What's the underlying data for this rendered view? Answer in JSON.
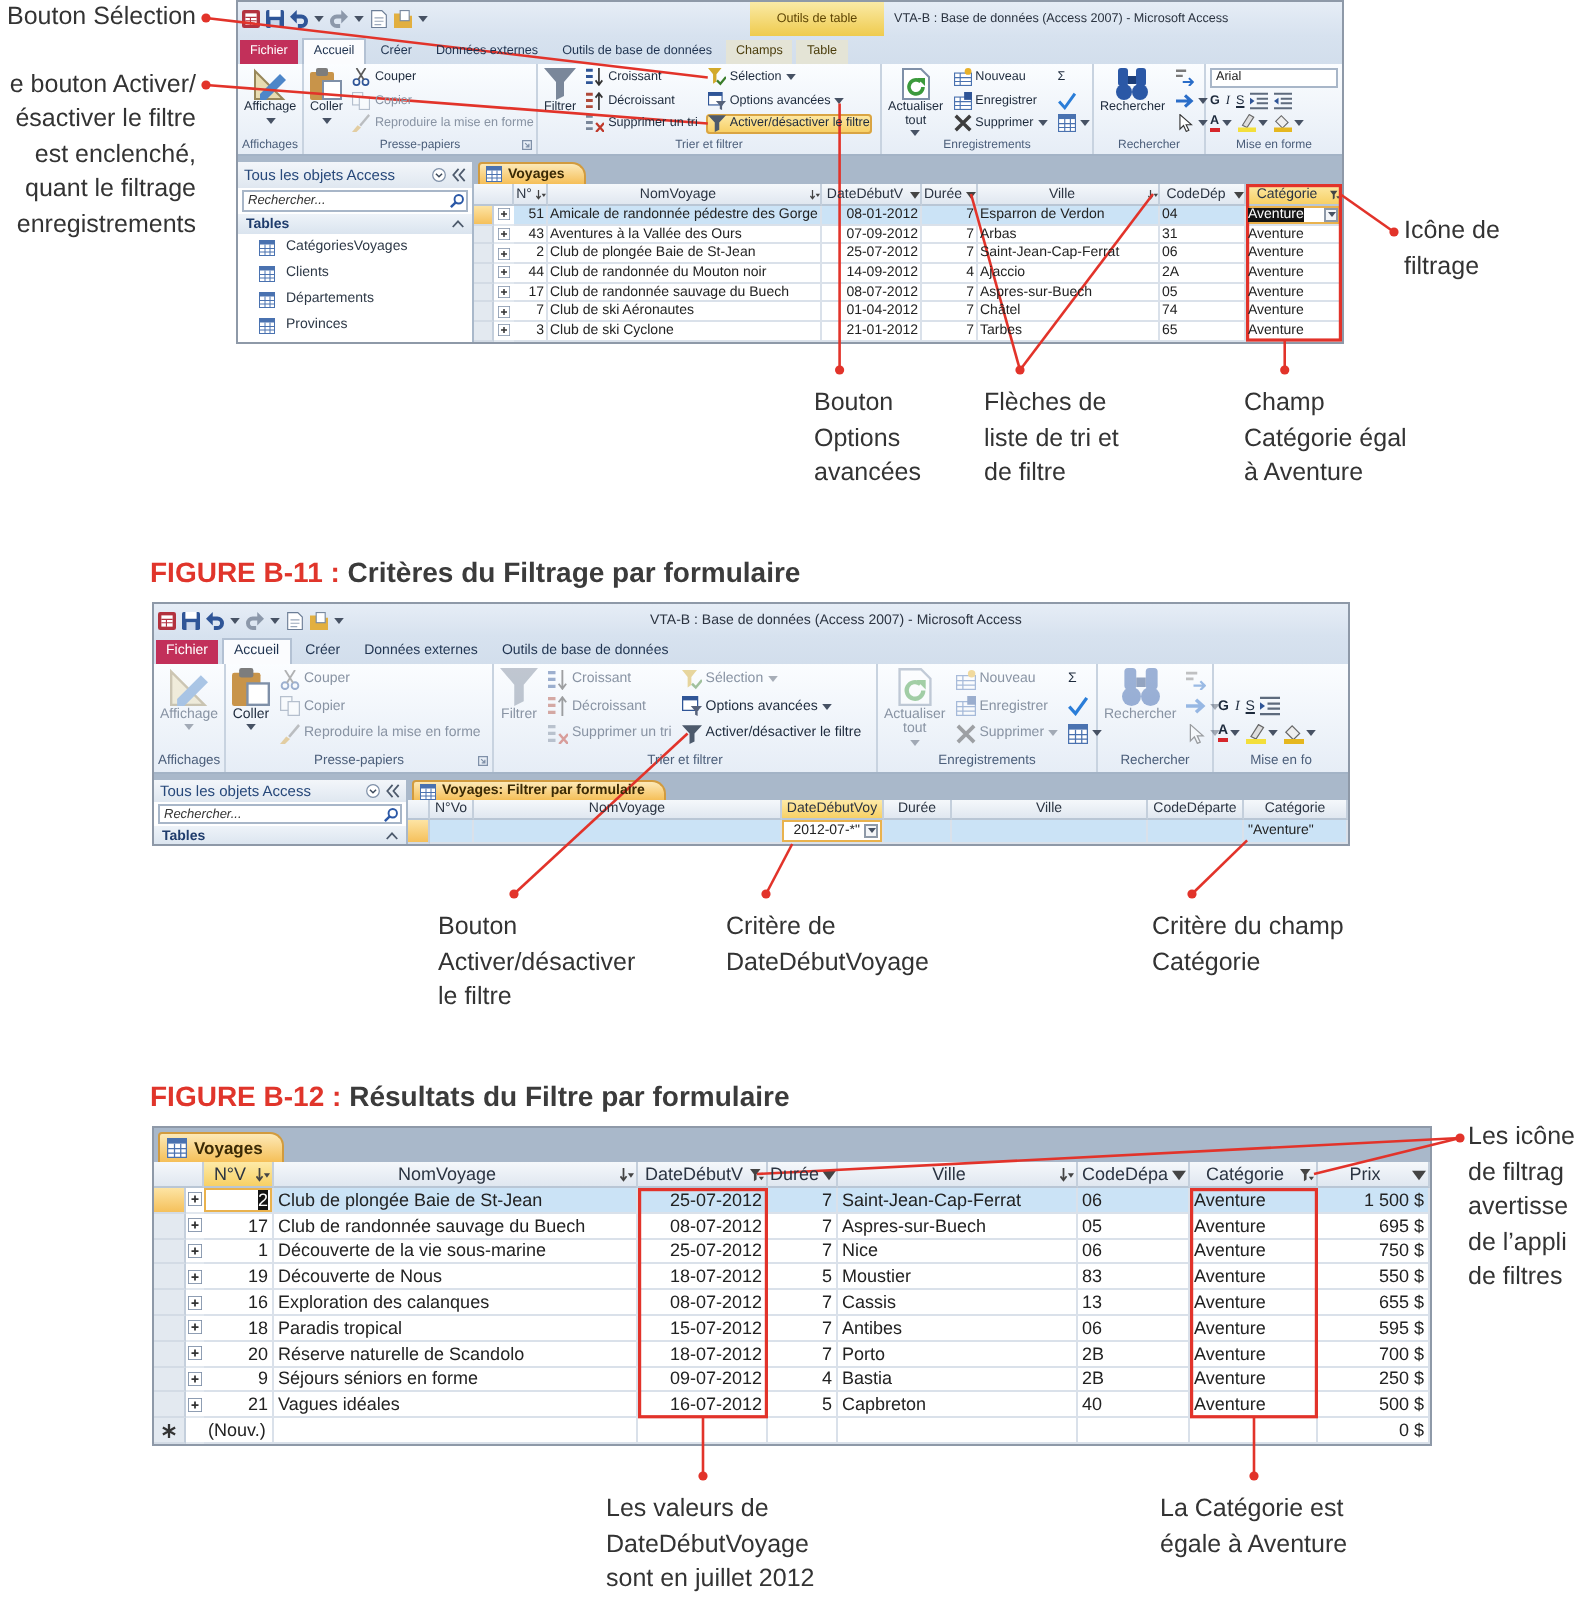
{
  "figure_1": {
    "callouts_left": [
      {
        "lines": [
          "Bouton Sélection"
        ]
      },
      {
        "lines": [
          "e bouton Activer/",
          "ésactiver le filtre",
          "est enclenché,",
          "quant le filtrage",
          "enregistrements"
        ]
      }
    ],
    "window": {
      "title": "VTA-B : Base de données (Access 2007) - Microsoft Access",
      "context_group": "Outils de table",
      "tabs": [
        {
          "label": "Fichier",
          "kind": "file",
          "selected": false
        },
        {
          "label": "Accueil",
          "kind": "tab",
          "selected": true
        },
        {
          "label": "Créer",
          "kind": "tab",
          "selected": false
        },
        {
          "label": "Données externes",
          "kind": "tab",
          "selected": false
        },
        {
          "label": "Outils de base de données",
          "kind": "tab",
          "selected": false
        },
        {
          "label": "Champs",
          "kind": "context",
          "selected": false
        },
        {
          "label": "Table",
          "kind": "context",
          "selected": false
        }
      ],
      "ribbon": [
        {
          "label": "Affichages",
          "kind": "buttons",
          "controls": [
            {
              "kind": "large",
              "label": "Affichage",
              "menu": true,
              "disabled": false
            }
          ]
        },
        {
          "label": "Presse-papiers",
          "kind": "buttons",
          "launcher": true,
          "controls": [
            {
              "kind": "large",
              "label": "Coller",
              "menu": true,
              "disabled": false
            },
            {
              "kind": "small",
              "label": "Couper",
              "disabled": false
            },
            {
              "kind": "small",
              "label": "Copier",
              "disabled": true
            },
            {
              "kind": "small",
              "label": "Reproduire la mise en forme",
              "disabled": true
            }
          ]
        },
        {
          "label": "Trier et filtrer",
          "kind": "buttons",
          "controls": [
            {
              "kind": "large",
              "label": "Filtrer",
              "disabled": false
            },
            {
              "kind": "small",
              "label": "Croissant",
              "disabled": false
            },
            {
              "kind": "small",
              "label": "Décroissant",
              "disabled": false
            },
            {
              "kind": "small",
              "label": "Supprimer un tri",
              "disabled": false
            },
            {
              "kind": "small",
              "label": "Sélection",
              "menu": true,
              "disabled": false
            },
            {
              "kind": "small",
              "label": "Options avancées",
              "menu": true,
              "disabled": false
            },
            {
              "kind": "small",
              "label": "Activer/désactiver le filtre",
              "disabled": false,
              "pressed": true
            }
          ]
        },
        {
          "label": "Enregistrements",
          "kind": "buttons",
          "controls": [
            {
              "kind": "large",
              "label": "Actualiser tout",
              "menu": true,
              "disabled": false
            },
            {
              "kind": "small",
              "label": "Nouveau",
              "disabled": false
            },
            {
              "kind": "small",
              "label": "Enregistrer",
              "disabled": false
            },
            {
              "kind": "small",
              "label": "Supprimer",
              "menu": true,
              "disabled": false
            },
            {
              "kind": "icon",
              "label": "Σ",
              "disabled": false
            },
            {
              "kind": "icon",
              "disabled": false
            },
            {
              "kind": "icon",
              "menu": true,
              "disabled": false
            }
          ]
        },
        {
          "label": "Rechercher",
          "kind": "buttons",
          "controls": [
            {
              "kind": "large",
              "label": "Rechercher",
              "disabled": false
            },
            {
              "kind": "icon",
              "disabled": false
            },
            {
              "kind": "icon",
              "menu": true,
              "disabled": false
            },
            {
              "kind": "icon",
              "menu": true,
              "disabled": false
            }
          ]
        },
        {
          "label": "Mise en forme",
          "kind": "format",
          "font": "Arial",
          "rows": [
            [
              {
                "kind": "bold",
                "label": "G"
              },
              {
                "kind": "italic",
                "label": "I"
              },
              {
                "kind": "underline",
                "label": "S"
              },
              {
                "kind": "icon"
              },
              {
                "kind": "icon"
              }
            ],
            [
              {
                "kind": "color",
                "label": "A",
                "menu": true
              },
              {
                "kind": "icon",
                "menu": true
              },
              {
                "kind": "icon",
                "menu": true
              }
            ]
          ]
        }
      ],
      "navigation_pane": {
        "title": "Tous les objets Access",
        "search": {
          "placeholder": "Rechercher..."
        },
        "section": "Tables",
        "items": [
          "CatégoriesVoyages",
          "Clients",
          "Départements",
          "Provinces"
        ]
      },
      "datasheet": {
        "tab": "Voyages",
        "expandable": true,
        "column_menus": true,
        "focus_dropdown": true,
        "columns": [
          {
            "label": "N°",
            "kind": "number",
            "sorted": true,
            "filtered": false,
            "selected": false
          },
          {
            "label": "NomVoyage",
            "kind": "text",
            "sorted": true,
            "filtered": false,
            "selected": false
          },
          {
            "label": "DateDébutV",
            "kind": "date",
            "sorted": false,
            "filtered": false,
            "selected": false
          },
          {
            "label": "Durée",
            "kind": "number",
            "sorted": false,
            "filtered": false,
            "selected": false
          },
          {
            "label": "Ville",
            "kind": "text",
            "sorted": true,
            "filtered": false,
            "selected": false
          },
          {
            "label": "CodeDép",
            "kind": "text",
            "sorted": false,
            "filtered": false,
            "selected": false
          },
          {
            "label": "Catégorie",
            "kind": "text",
            "sorted": false,
            "filtered": true,
            "selected": true,
            "framed": true
          }
        ],
        "rows": [
          {
            "kind": "record",
            "selected": true,
            "cells": [
              "51",
              "Amicale de randonnée pédestre des Gorge",
              "08-01-2012",
              "7",
              "Esparron de Verdon",
              "04",
              "Aventure"
            ]
          },
          {
            "kind": "record",
            "selected": false,
            "cells": [
              "43",
              "Aventures à la Vallée des Ours",
              "07-09-2012",
              "7",
              "Arbas",
              "31",
              "Aventure"
            ]
          },
          {
            "kind": "record",
            "selected": false,
            "cells": [
              "2",
              "Club de plongée Baie de St-Jean",
              "25-07-2012",
              "7",
              "Saint-Jean-Cap-Ferrat",
              "06",
              "Aventure"
            ]
          },
          {
            "kind": "record",
            "selected": false,
            "cells": [
              "44",
              "Club de randonnée du Mouton noir",
              "14-09-2012",
              "4",
              "Ajaccio",
              "2A",
              "Aventure"
            ]
          },
          {
            "kind": "record",
            "selected": false,
            "cells": [
              "17",
              "Club de randonnée sauvage du Buech",
              "08-07-2012",
              "7",
              "Aspres-sur-Buech",
              "05",
              "Aventure"
            ]
          },
          {
            "kind": "record",
            "selected": false,
            "cells": [
              "7",
              "Club de ski Aéronautes",
              "01-04-2012",
              "7",
              "Châtel",
              "74",
              "Aventure"
            ]
          },
          {
            "kind": "record",
            "selected": false,
            "cells": [
              "3",
              "Club de ski Cyclone",
              "21-01-2012",
              "7",
              "Tarbes",
              "65",
              "Aventure"
            ]
          }
        ]
      }
    },
    "callouts_right": [
      {
        "lines": [
          "Icône de",
          "filtrage"
        ]
      }
    ],
    "callouts_below": [
      {
        "lines": [
          "Bouton",
          "Options",
          "avancées"
        ]
      },
      {
        "lines": [
          "Flèches de",
          "liste de tri et",
          "de filtre"
        ]
      },
      {
        "lines": [
          "Champ",
          "Catégorie égal",
          "à Aventure"
        ]
      }
    ]
  },
  "figure_2": {
    "caption": {
      "number": "FIGURE B-11 :",
      "title": "Critères du Filtrage par formulaire"
    },
    "window": {
      "title": "VTA-B : Base de données (Access 2007) - Microsoft Access",
      "tabs": [
        {
          "label": "Fichier",
          "kind": "file",
          "selected": false
        },
        {
          "label": "Accueil",
          "kind": "tab",
          "selected": true
        },
        {
          "label": "Créer",
          "kind": "tab",
          "selected": false
        },
        {
          "label": "Données externes",
          "kind": "tab",
          "selected": false
        },
        {
          "label": "Outils de base de données",
          "kind": "tab",
          "selected": false
        }
      ],
      "ribbon": [
        {
          "label": "Affichages",
          "kind": "buttons",
          "controls": [
            {
              "kind": "large",
              "label": "Affichage",
              "menu": true,
              "disabled": true
            }
          ]
        },
        {
          "label": "Presse-papiers",
          "kind": "buttons",
          "launcher": true,
          "controls": [
            {
              "kind": "large",
              "label": "Coller",
              "menu": true,
              "disabled": false
            },
            {
              "kind": "small",
              "label": "Couper",
              "disabled": true
            },
            {
              "kind": "small",
              "label": "Copier",
              "disabled": true
            },
            {
              "kind": "small",
              "label": "Reproduire la mise en forme",
              "disabled": true
            }
          ]
        },
        {
          "label": "Trier et filtrer",
          "kind": "buttons",
          "controls": [
            {
              "kind": "large",
              "label": "Filtrer",
              "disabled": true
            },
            {
              "kind": "small",
              "label": "Croissant",
              "disabled": true
            },
            {
              "kind": "small",
              "label": "Décroissant",
              "disabled": true
            },
            {
              "kind": "small",
              "label": "Supprimer un tri",
              "disabled": true
            },
            {
              "kind": "small",
              "label": "Sélection",
              "menu": true,
              "disabled": true
            },
            {
              "kind": "small",
              "label": "Options avancées",
              "menu": true,
              "disabled": false
            },
            {
              "kind": "small",
              "label": "Activer/désactiver le filtre",
              "disabled": false,
              "pressed": false
            }
          ]
        },
        {
          "label": "Enregistrements",
          "kind": "buttons",
          "controls": [
            {
              "kind": "large",
              "label": "Actualiser tout",
              "menu": true,
              "disabled": true
            },
            {
              "kind": "small",
              "label": "Nouveau",
              "disabled": true
            },
            {
              "kind": "small",
              "label": "Enregistrer",
              "disabled": true
            },
            {
              "kind": "small",
              "label": "Supprimer",
              "menu": true,
              "disabled": true
            },
            {
              "kind": "icon",
              "label": "Σ",
              "disabled": false
            },
            {
              "kind": "icon",
              "disabled": false
            },
            {
              "kind": "icon",
              "menu": true,
              "disabled": false
            }
          ]
        },
        {
          "label": "Rechercher",
          "kind": "buttons",
          "controls": [
            {
              "kind": "large",
              "label": "Rechercher",
              "disabled": true
            },
            {
              "kind": "icon",
              "disabled": true
            },
            {
              "kind": "icon",
              "menu": true,
              "disabled": true
            },
            {
              "kind": "icon",
              "menu": true,
              "disabled": true
            }
          ]
        },
        {
          "label": "Mise en fo",
          "kind": "format",
          "rows": [
            [
              {
                "kind": "bold",
                "label": "G"
              },
              {
                "kind": "italic",
                "label": "I"
              },
              {
                "kind": "underline",
                "label": "S"
              },
              {
                "kind": "icon"
              }
            ],
            [
              {
                "kind": "color",
                "label": "A",
                "menu": true
              },
              {
                "kind": "icon",
                "menu": true
              },
              {
                "kind": "icon",
                "menu": true
              }
            ]
          ]
        }
      ],
      "navigation_pane": {
        "title": "Tous les objets Access",
        "search": {
          "placeholder": "Rechercher..."
        },
        "section": "Tables"
      },
      "datasheet": {
        "tab": "Voyages: Filtrer par formulaire",
        "focus_dropdown": true,
        "columns": [
          {
            "label": "N°Vo",
            "kind": "number",
            "selected": false
          },
          {
            "label": "NomVoyage",
            "kind": "text",
            "selected": false
          },
          {
            "label": "DateDébutVoy",
            "kind": "date",
            "selected": true
          },
          {
            "label": "Durée",
            "kind": "number",
            "selected": false
          },
          {
            "label": "Ville",
            "kind": "text",
            "selected": false
          },
          {
            "label": "CodeDéparte",
            "kind": "text",
            "selected": false
          },
          {
            "label": "Catégorie",
            "kind": "text",
            "selected": false
          }
        ],
        "rows": [
          {
            "kind": "criteria",
            "selected": true,
            "cells": [
              null,
              null,
              "2012-07-*\"",
              null,
              null,
              null,
              "\"Aventure\""
            ]
          }
        ]
      }
    },
    "callouts_below": [
      {
        "lines": [
          "Bouton",
          "Activer/désactiver",
          "le filtre"
        ]
      },
      {
        "lines": [
          "Critère de",
          "DateDébutVoyage"
        ]
      },
      {
        "lines": [
          "Critère du champ",
          "Catégorie"
        ]
      }
    ]
  },
  "figure_3": {
    "caption": {
      "number": "FIGURE B-12 :",
      "title": "Résultats du Filtre par formulaire"
    },
    "datasheet": {
      "tab": "Voyages",
      "expandable": true,
      "column_menus": true,
      "columns": [
        {
          "label": "N°V",
          "kind": "number",
          "sorted": true,
          "filtered": false,
          "selected": true
        },
        {
          "label": "NomVoyage",
          "kind": "text",
          "sorted": true,
          "filtered": false,
          "selected": false
        },
        {
          "label": "DateDébutV",
          "kind": "date",
          "sorted": false,
          "filtered": true,
          "selected": false,
          "framed": true
        },
        {
          "label": "Durée",
          "kind": "number",
          "sorted": false,
          "filtered": false,
          "selected": false
        },
        {
          "label": "Ville",
          "kind": "text",
          "sorted": true,
          "filtered": false,
          "selected": false
        },
        {
          "label": "CodeDépa",
          "kind": "text",
          "sorted": false,
          "filtered": false,
          "selected": false
        },
        {
          "label": "Catégorie",
          "kind": "text",
          "sorted": false,
          "filtered": true,
          "selected": false,
          "framed": true
        },
        {
          "label": "Prix",
          "kind": "currency",
          "sorted": false,
          "filtered": false,
          "selected": false
        }
      ],
      "rows": [
        {
          "kind": "record",
          "selected": true,
          "cells": [
            "2",
            "Club de plongée Baie de St-Jean",
            "25-07-2012",
            "7",
            "Saint-Jean-Cap-Ferrat",
            "06",
            "Aventure",
            "1 500 $"
          ]
        },
        {
          "kind": "record",
          "selected": false,
          "cells": [
            "17",
            "Club de randonnée sauvage du Buech",
            "08-07-2012",
            "7",
            "Aspres-sur-Buech",
            "05",
            "Aventure",
            "695 $"
          ]
        },
        {
          "kind": "record",
          "selected": false,
          "cells": [
            "1",
            "Découverte de la vie sous-marine",
            "25-07-2012",
            "7",
            "Nice",
            "06",
            "Aventure",
            "750 $"
          ]
        },
        {
          "kind": "record",
          "selected": false,
          "cells": [
            "19",
            "Découverte de Nous",
            "18-07-2012",
            "5",
            "Moustier",
            "83",
            "Aventure",
            "550 $"
          ]
        },
        {
          "kind": "record",
          "selected": false,
          "cells": [
            "16",
            "Exploration des calanques",
            "08-07-2012",
            "7",
            "Cassis",
            "13",
            "Aventure",
            "655 $"
          ]
        },
        {
          "kind": "record",
          "selected": false,
          "cells": [
            "18",
            "Paradis tropical",
            "15-07-2012",
            "7",
            "Antibes",
            "06",
            "Aventure",
            "595 $"
          ]
        },
        {
          "kind": "record",
          "selected": false,
          "cells": [
            "20",
            "Réserve naturelle de Scandolo",
            "18-07-2012",
            "7",
            "Porto",
            "2B",
            "Aventure",
            "700 $"
          ]
        },
        {
          "kind": "record",
          "selected": false,
          "cells": [
            "9",
            "Séjours séniors en forme",
            "09-07-2012",
            "4",
            "Bastia",
            "2B",
            "Aventure",
            "250 $"
          ]
        },
        {
          "kind": "record",
          "selected": false,
          "cells": [
            "21",
            "Vagues idéales",
            "16-07-2012",
            "5",
            "Capbreton",
            "40",
            "Aventure",
            "500 $"
          ]
        },
        {
          "kind": "new",
          "selected": false,
          "cells": [
            "(Nouv.)",
            null,
            null,
            null,
            null,
            null,
            null,
            "0 $"
          ]
        }
      ]
    },
    "callouts_right": [
      {
        "lines": [
          "Les icône",
          "de filtrag",
          "avertisse",
          "de l’appli",
          "de filtres"
        ]
      }
    ],
    "callouts_below": [
      {
        "lines": [
          "Les valeurs de",
          "DateDébutVoyage",
          "sont en juillet 2012"
        ]
      },
      {
        "lines": [
          "La Catégorie est",
          "égale à Aventure"
        ]
      }
    ]
  }
}
